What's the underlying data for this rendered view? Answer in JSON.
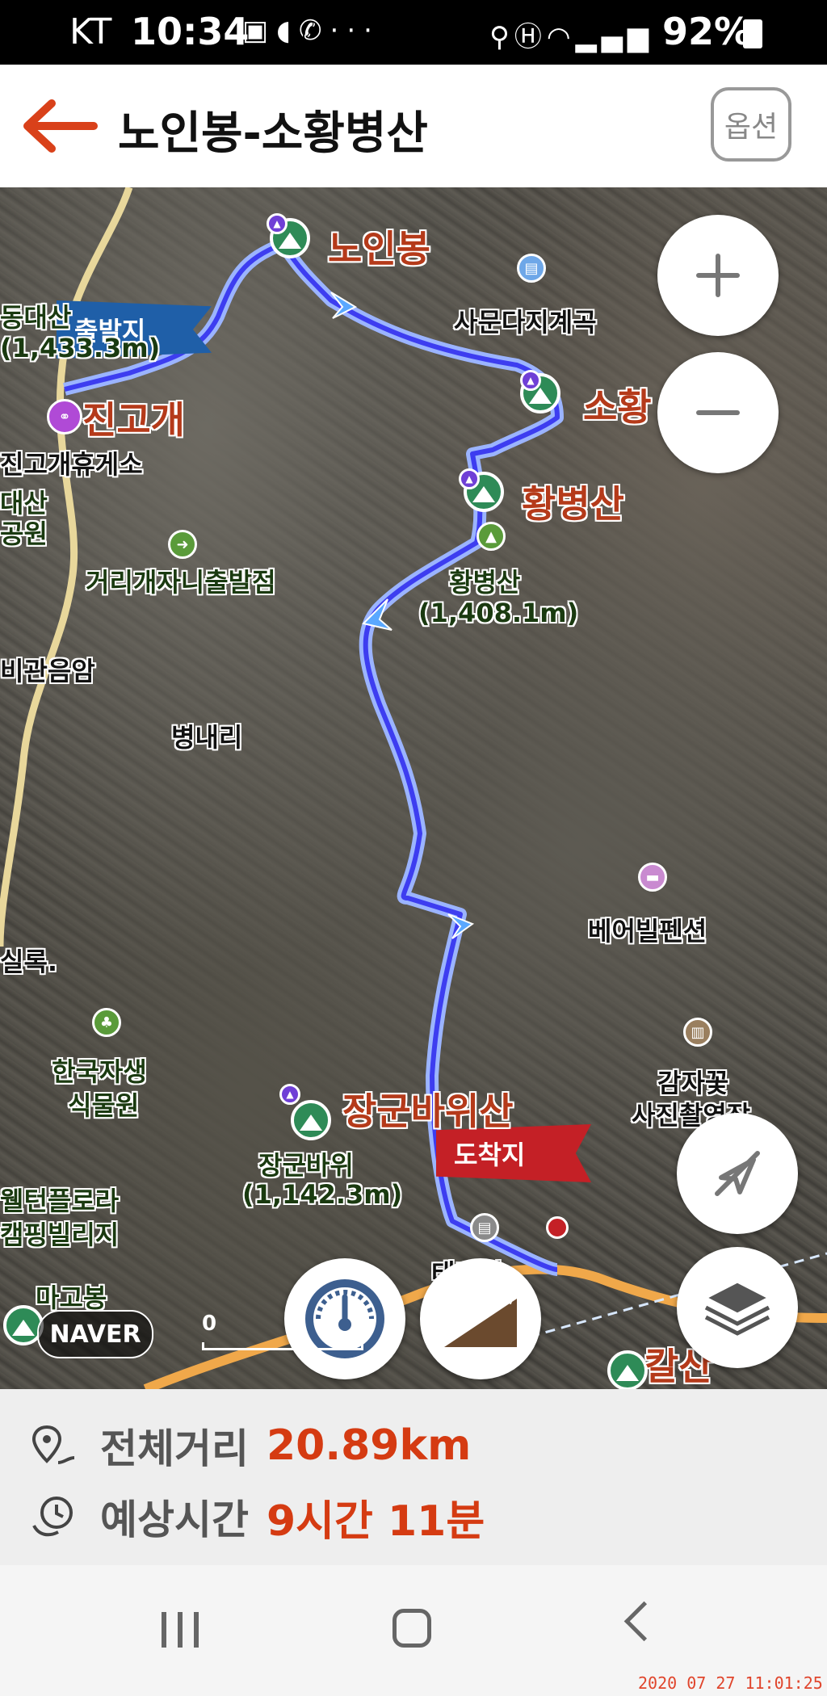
{
  "status_bar": {
    "carrier": "KT",
    "time": "10:34",
    "battery_percent": "92%",
    "icons": [
      "image-icon",
      "pill-icon",
      "wifi-call-icon",
      "more-icon",
      "location-icon",
      "hd-icon",
      "wifi-icon",
      "signal-icon",
      "battery-icon"
    ]
  },
  "header": {
    "title": "노인봉-소황병산",
    "option_label": "옵션"
  },
  "map": {
    "labels": {
      "noinbong": "노인봉",
      "sahwang": "소황",
      "hwangbyeongsan": "황병산",
      "jingogae": "진고개",
      "jingogae_rest": "진고개휴게소",
      "samundaji": "사문다지계곡",
      "georigaeja": "거리개자니출발점",
      "hwangbyeongsan_peak": "황병산",
      "hwangbyeongsan_elev": "(1,408.1m)",
      "daesan": "대산",
      "gongwon": "공원",
      "gwaneumam": "비관음암",
      "byeongnaeri": "병내리",
      "sillok": "실록.",
      "beoerbil": "베어빌펜션",
      "gamjakkot": "감자꽃",
      "sajin": "사진촬영장",
      "hanguk1": "한국자생",
      "hanguk2": "식물원",
      "janggun_big": "장군바위산",
      "janggun": "장군바위",
      "janggun_elev": "(1,142.3m)",
      "welton1": "웰턴플로라",
      "welton2": "캠핑빌리지",
      "dongdaesan": "동대산",
      "dongdaesan_elev": "(1,433.3m)",
      "kalsan": "칼산",
      "taegi": "태기역",
      "magobong": "마고봉"
    },
    "start_flag": "출발지",
    "end_flag": "도착지",
    "naver_logo": "NAVER",
    "scale_zero": "0",
    "route_color": "#3d3df0"
  },
  "summary": {
    "distance_label": "전체거리",
    "distance_value": "20.89km",
    "time_label": "예상시간",
    "time_value": "9시간 11분",
    "accent_color": "#d53b12"
  },
  "watermark": "2020 07 27 11:01:25"
}
